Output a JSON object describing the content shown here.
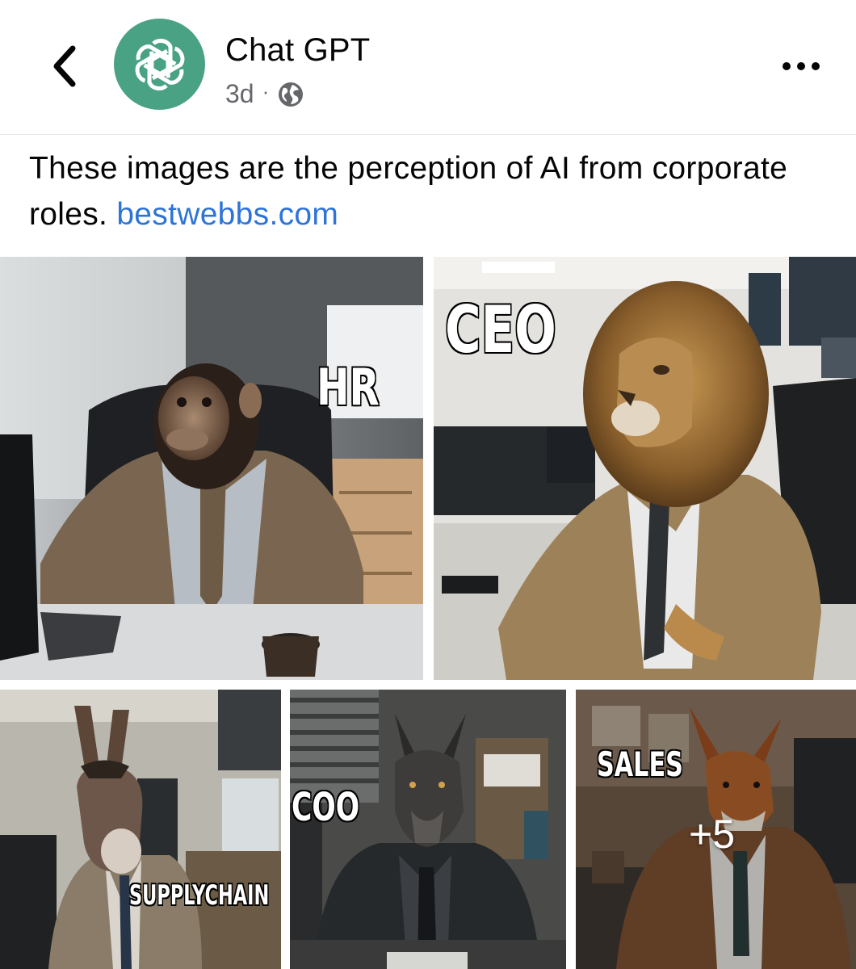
{
  "post": {
    "author_name": "Chat GPT",
    "time_ago": "3d",
    "separator": "·",
    "privacy_icon": "globe-icon",
    "text": "These images are the perception of AI from corporate roles.",
    "link_text": "bestwebbs.com"
  },
  "photos": [
    {
      "caption": "HR",
      "subject": "chimpanzee in brown suit at office desk"
    },
    {
      "caption": "CEO",
      "subject": "lion in tan suit at office desk"
    },
    {
      "caption": "SUPPLYCHAIN",
      "subject": "donkey in suit in office"
    },
    {
      "caption": "COO",
      "subject": "wolf in dark suit in office"
    },
    {
      "caption": "SALES",
      "subject": "fox in brown suit in office"
    }
  ],
  "more_count": "+5",
  "colors": {
    "avatar_bg": "#4aa285",
    "link": "#2d74d9",
    "meta_text": "#65676b"
  },
  "icons": [
    "back-chevron-icon",
    "openai-logo-icon",
    "globe-icon",
    "more-options-icon"
  ]
}
